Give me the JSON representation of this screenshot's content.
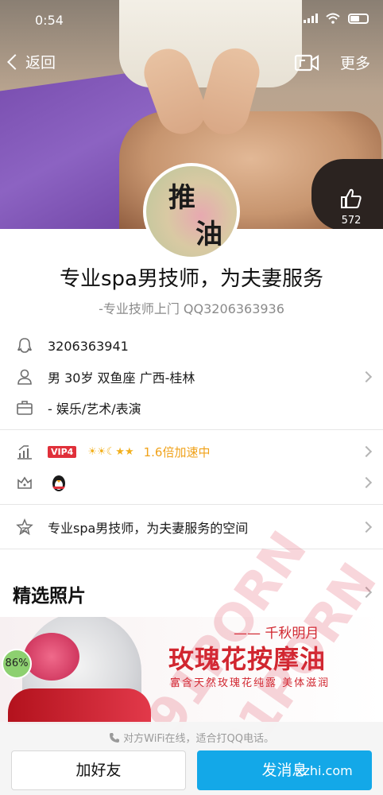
{
  "status_bar": {
    "time": "0:54"
  },
  "nav": {
    "back_label": "返回",
    "more_label": "更多"
  },
  "like": {
    "count": "572"
  },
  "avatar": {
    "char1": "推",
    "char2": "油"
  },
  "profile": {
    "nickname": "专业spa男技师，为夫妻服务",
    "signature": "-专业技师上门 QQ3206363936"
  },
  "info": {
    "qq": "3206363941",
    "basic": "男  30岁  双鱼座  广西-桂林",
    "job": "- 娱乐/艺术/表演"
  },
  "level": {
    "vip_badge": "VIP4",
    "level_icons": "☀☀☾★★",
    "speed_text": "1.6倍加速中"
  },
  "space": {
    "label": "专业spa男技师，为夫妻服务的空间"
  },
  "section": {
    "photos_title": "精选照片"
  },
  "photo_banner": {
    "brand": "—— 千秋明月",
    "headline": "玫瑰花按摩油",
    "sub": "富含天然玫瑰花纯露  美体滋润",
    "badge": "86%"
  },
  "bottom": {
    "hint": "对方WiFi在线，适合打QQ电话。",
    "add_friend": "加好友",
    "send_message": "发消息"
  },
  "watermark": {
    "line1": "91PORN",
    "line2": "91PORN",
    "site": "xzhi.com"
  },
  "colors": {
    "accent": "#13a8e8",
    "vip": "#e0303a",
    "speed": "#f0a21a"
  }
}
